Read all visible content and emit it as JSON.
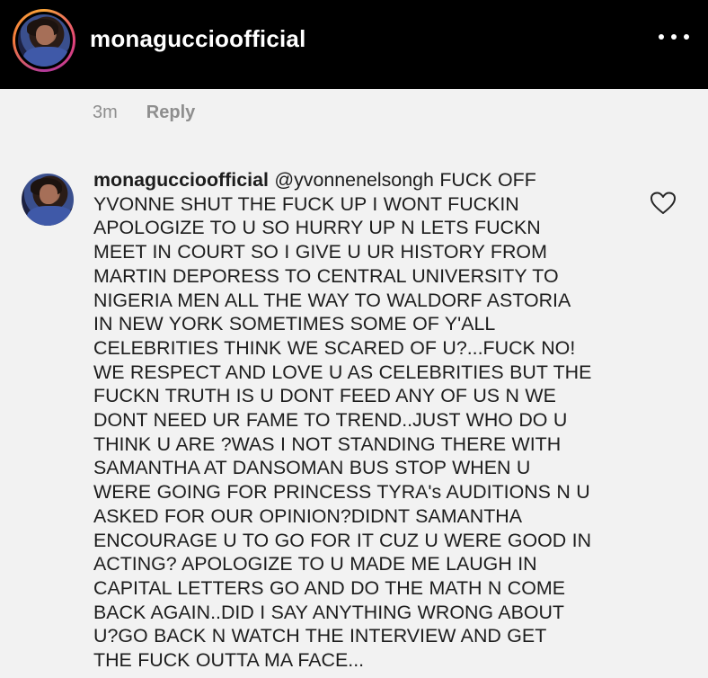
{
  "header": {
    "username": "monaguccioofficial"
  },
  "comment_meta": {
    "time": "3m",
    "reply_label": "Reply"
  },
  "comment": {
    "username": "monaguccioofficial",
    "mention": "@yvonnenelsongh",
    "lines": [
      "FUCK OFF",
      "YVONNE SHUT THE FUCK UP I WONT FUCKIN",
      "APOLOGIZE TO U SO HURRY UP N LETS FUCKN",
      "MEET IN COURT SO I GIVE U UR HISTORY FROM",
      "MARTIN DEPORESS TO CENTRAL UNIVERSITY TO",
      "NIGERIA MEN ALL THE WAY TO WALDORF ASTORIA",
      "IN NEW YORK SOMETIMES SOME OF Y'ALL",
      "CELEBRITIES THINK WE SCARED OF U?...FUCK NO!",
      "WE RESPECT AND LOVE U AS CELEBRITIES BUT THE",
      "FUCKN TRUTH IS U DONT FEED ANY OF US N WE",
      "DONT NEED UR FAME TO TREND..JUST WHO DO U",
      "THINK U ARE ?WAS I NOT STANDING THERE WITH",
      "SAMANTHA AT DANSOMAN BUS STOP WHEN U",
      "WERE GOING FOR PRINCESS TYRA's AUDITIONS N U",
      "ASKED FOR OUR OPINION?DIDNT SAMANTHA",
      "ENCOURAGE U TO GO FOR IT CUZ U WERE GOOD IN",
      "ACTING? APOLOGIZE TO U MADE ME LAUGH IN",
      "CAPITAL LETTERS GO AND DO THE MATH N COME",
      "BACK AGAIN..DID I SAY ANYTHING WRONG ABOUT",
      "U?GO BACK N WATCH THE INTERVIEW AND GET",
      "THE FUCK OUTTA MA FACE..."
    ]
  },
  "icons": {
    "more": "more-options-icon",
    "like": "heart-icon"
  }
}
